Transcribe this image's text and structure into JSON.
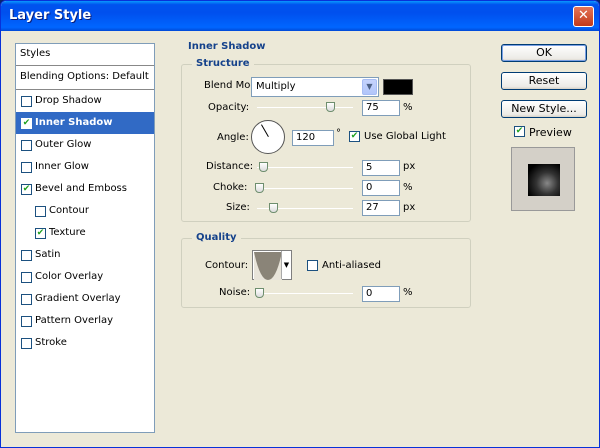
{
  "window": {
    "title": "Layer Style"
  },
  "styles": {
    "header": "Styles",
    "blending": "Blending Options: Default",
    "items": [
      {
        "label": "Drop Shadow",
        "checked": false,
        "selected": false,
        "sub": false
      },
      {
        "label": "Inner Shadow",
        "checked": true,
        "selected": true,
        "sub": false
      },
      {
        "label": "Outer Glow",
        "checked": false,
        "selected": false,
        "sub": false
      },
      {
        "label": "Inner Glow",
        "checked": false,
        "selected": false,
        "sub": false
      },
      {
        "label": "Bevel and Emboss",
        "checked": true,
        "selected": false,
        "sub": false
      },
      {
        "label": "Contour",
        "checked": false,
        "selected": false,
        "sub": true
      },
      {
        "label": "Texture",
        "checked": true,
        "selected": false,
        "sub": true
      },
      {
        "label": "Satin",
        "checked": false,
        "selected": false,
        "sub": false
      },
      {
        "label": "Color Overlay",
        "checked": false,
        "selected": false,
        "sub": false
      },
      {
        "label": "Gradient Overlay",
        "checked": false,
        "selected": false,
        "sub": false
      },
      {
        "label": "Pattern Overlay",
        "checked": false,
        "selected": false,
        "sub": false
      },
      {
        "label": "Stroke",
        "checked": false,
        "selected": false,
        "sub": false
      }
    ]
  },
  "inner_shadow": {
    "title": "Inner Shadow",
    "structure": {
      "title": "Structure",
      "blend_mode_label": "Blend Mode:",
      "blend_mode_value": "Multiply",
      "shadow_color": "#000000",
      "opacity_label": "Opacity:",
      "opacity_value": "75",
      "opacity_unit": "%",
      "angle_label": "Angle:",
      "angle_value": "120",
      "angle_unit": "°",
      "use_global_light_label": "Use Global Light",
      "use_global_light": true,
      "distance_label": "Distance:",
      "distance_value": "5",
      "distance_unit": "px",
      "choke_label": "Choke:",
      "choke_value": "0",
      "choke_unit": "%",
      "size_label": "Size:",
      "size_value": "27",
      "size_unit": "px"
    },
    "quality": {
      "title": "Quality",
      "contour_label": "Contour:",
      "anti_aliased_label": "Anti-aliased",
      "anti_aliased": false,
      "noise_label": "Noise:",
      "noise_value": "0",
      "noise_unit": "%"
    }
  },
  "buttons": {
    "ok": "OK",
    "reset": "Reset",
    "new_style": "New Style...",
    "preview_label": "Preview",
    "preview": true
  },
  "check_glyph": "✔"
}
